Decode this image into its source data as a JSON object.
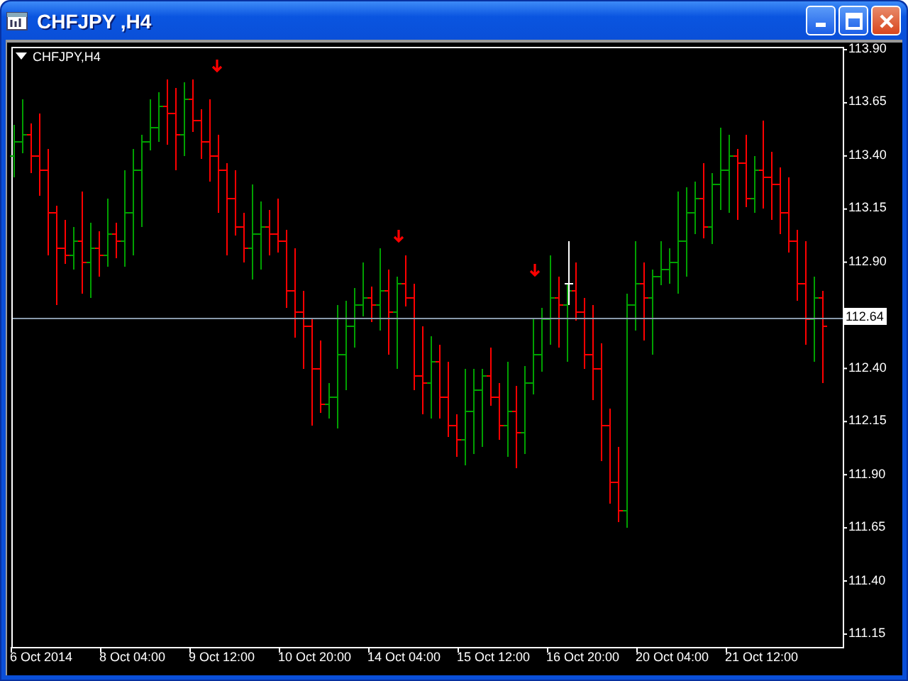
{
  "window": {
    "title": "CHFJPY ,H4"
  },
  "chart": {
    "label": "CHFJPY,H4",
    "price_labels": [
      "113.90",
      "113.65",
      "113.40",
      "113.15",
      "112.90",
      "112.40",
      "112.15",
      "111.90",
      "111.65",
      "111.40",
      "111.15"
    ],
    "current_price": "112.64",
    "time_labels": [
      "6 Oct 2014",
      "8 Oct 04:00",
      "9 Oct 12:00",
      "10 Oct 20:00",
      "14 Oct 04:00",
      "15 Oct 12:00",
      "16 Oct 20:00",
      "20 Oct 04:00",
      "21 Oct 12:00"
    ]
  }
}
